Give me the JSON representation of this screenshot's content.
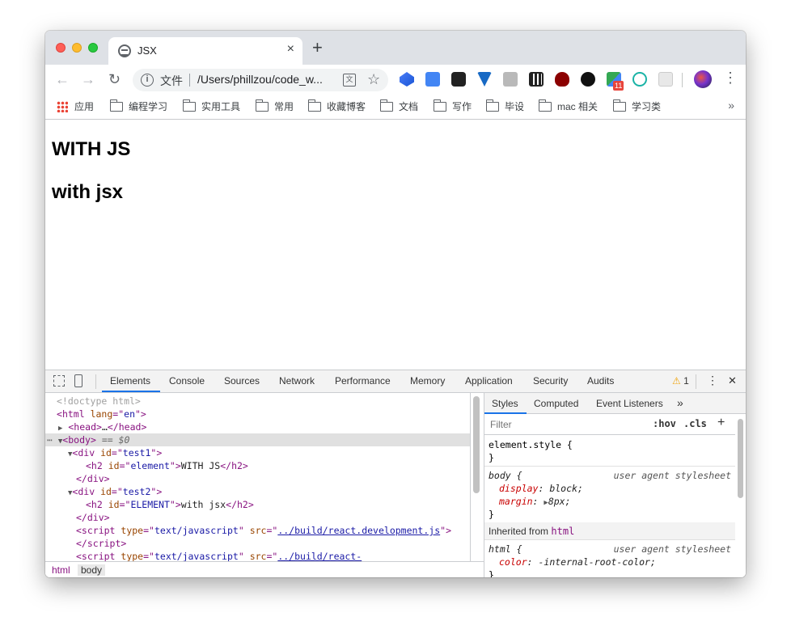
{
  "tab": {
    "title": "JSX",
    "close": "×",
    "new_tab": "+"
  },
  "toolbar": {
    "back": "←",
    "forward": "→",
    "reload": "↻",
    "secure_label": "文件",
    "url": "/Users/phillzou/code_w...",
    "ext_badge": "11",
    "menu": "⋮"
  },
  "bookmarks": {
    "items": [
      "应用",
      "编程学习",
      "实用工具",
      "常用",
      "收藏博客",
      "文档",
      "写作",
      "毕设",
      "mac 相关",
      "学习类"
    ],
    "more": "»"
  },
  "page": {
    "heading1": "WITH JS",
    "heading2": "with jsx"
  },
  "devtools": {
    "tabs": [
      "Elements",
      "Console",
      "Sources",
      "Network",
      "Performance",
      "Memory",
      "Application",
      "Security",
      "Audits"
    ],
    "active_tab": "Elements",
    "warnings_count": "1",
    "more": "⋮",
    "close": "✕",
    "elements": {
      "doctype": "<!doctype html>",
      "html_open": "html",
      "lang_attr": "lang",
      "lang_val": "en",
      "head_tag": "head",
      "head_ellipsis": "…",
      "body_tag": "body",
      "body_eq": "== $0",
      "div1_id": "test1",
      "h2_1_id": "element",
      "h2_1_text": "WITH JS",
      "div2_id": "test2",
      "h2_2_id": "ELEMENT",
      "h2_2_text": "with jsx",
      "script1_type": "text/javascript",
      "script1_src": "../build/react.development.js",
      "script2_type": "text/javascript",
      "script2_src": "../build/react-"
    },
    "breadcrumbs": [
      "html",
      "body"
    ],
    "styles": {
      "tabs": [
        "Styles",
        "Computed",
        "Event Listeners",
        "»"
      ],
      "filter_placeholder": "Filter",
      "hov": ":hov",
      "cls": ".cls",
      "plus": "+",
      "element_style": "element.style {",
      "close_brace": "}",
      "body_selector": "body {",
      "ua_origin": "user agent stylesheet",
      "body_props": [
        {
          "name": "display",
          "value": "block;"
        },
        {
          "name": "margin",
          "value": "8px;"
        }
      ],
      "inherited_label": "Inherited from",
      "inherited_tag": "html",
      "html_selector": "html {",
      "html_props": [
        {
          "name": "color",
          "value": "-internal-root-color;"
        }
      ]
    }
  },
  "colors": {
    "accent": "#1a73e8",
    "warning": "#f0a30a"
  }
}
